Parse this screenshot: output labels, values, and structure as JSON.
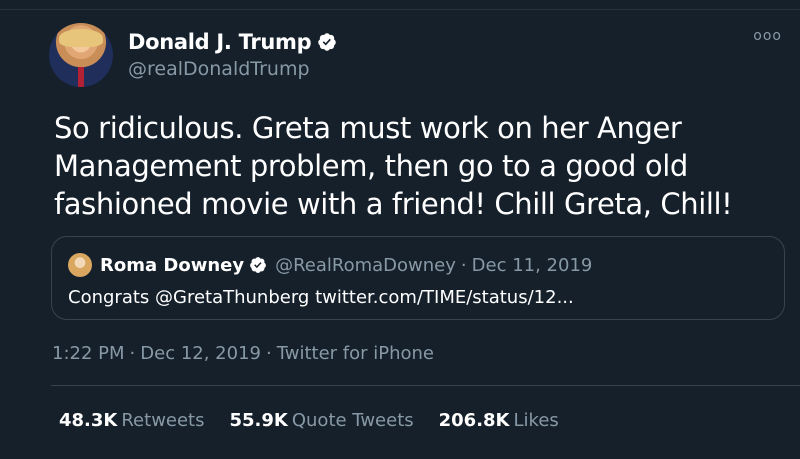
{
  "tweet": {
    "author": {
      "display_name": "Donald J. Trump",
      "handle": "@realDonaldTrump",
      "verified": true
    },
    "more_menu": "ooo",
    "text": "So ridiculous. Greta must work on her Anger Management problem, then go to a good old fashioned movie with a friend! Chill Greta, Chill!",
    "quoted": {
      "display_name": "Roma Downey",
      "handle": "@RealRomaDowney",
      "separator": "·",
      "date": "Dec 11, 2019",
      "text": "Congrats @GretaThunberg twitter.com/TIME/status/12..."
    },
    "meta": {
      "time": "1:22 PM",
      "date": "Dec 12, 2019",
      "source": "Twitter for iPhone",
      "separator": "·"
    },
    "stats": {
      "retweets_count": "48.3K",
      "retweets_label": "Retweets",
      "quotes_count": "55.9K",
      "quotes_label": "Quote Tweets",
      "likes_count": "206.8K",
      "likes_label": "Likes"
    }
  },
  "colors": {
    "background": "#15202b",
    "text_primary": "#ffffff",
    "text_secondary": "#8899a6",
    "border": "#38444d",
    "verified": "#ffffff"
  },
  "icons": {
    "verified": "verified-badge-icon",
    "more": "more-options-icon"
  }
}
